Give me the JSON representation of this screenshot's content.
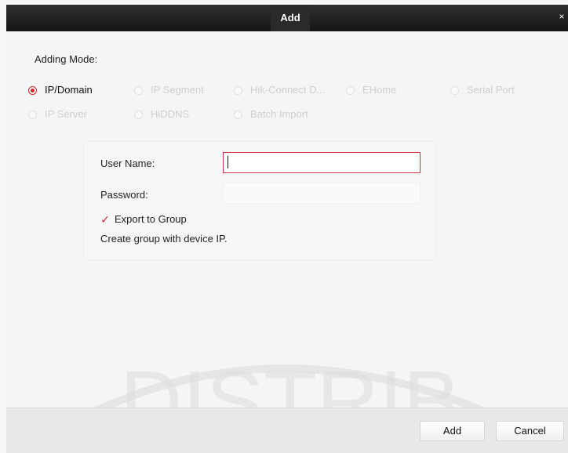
{
  "window": {
    "title": "Add",
    "close_glyph": "×"
  },
  "adding_mode": {
    "label": "Adding Mode:",
    "options": [
      {
        "label": "IP/Domain",
        "selected": true
      },
      {
        "label": "IP Segment",
        "selected": false
      },
      {
        "label": "Hik-Connect D...",
        "selected": false
      },
      {
        "label": "EHome",
        "selected": false
      },
      {
        "label": "Serial Port",
        "selected": false
      },
      {
        "label": "IP Server",
        "selected": false
      },
      {
        "label": "HiDDNS",
        "selected": false
      },
      {
        "label": "Batch Import",
        "selected": false
      }
    ]
  },
  "form": {
    "user_name_label": "User Name:",
    "user_name_value": "",
    "password_label": "Password:",
    "password_value": "",
    "export_to_group_label": "Export to Group",
    "export_to_group_checked": true,
    "hint": "Create group with device IP."
  },
  "footer": {
    "add_label": "Add",
    "cancel_label": "Cancel"
  },
  "watermark": {
    "text": "DISTRIB"
  },
  "colors": {
    "accent": "#d2232a",
    "titlebar": "#1f1f1f"
  }
}
